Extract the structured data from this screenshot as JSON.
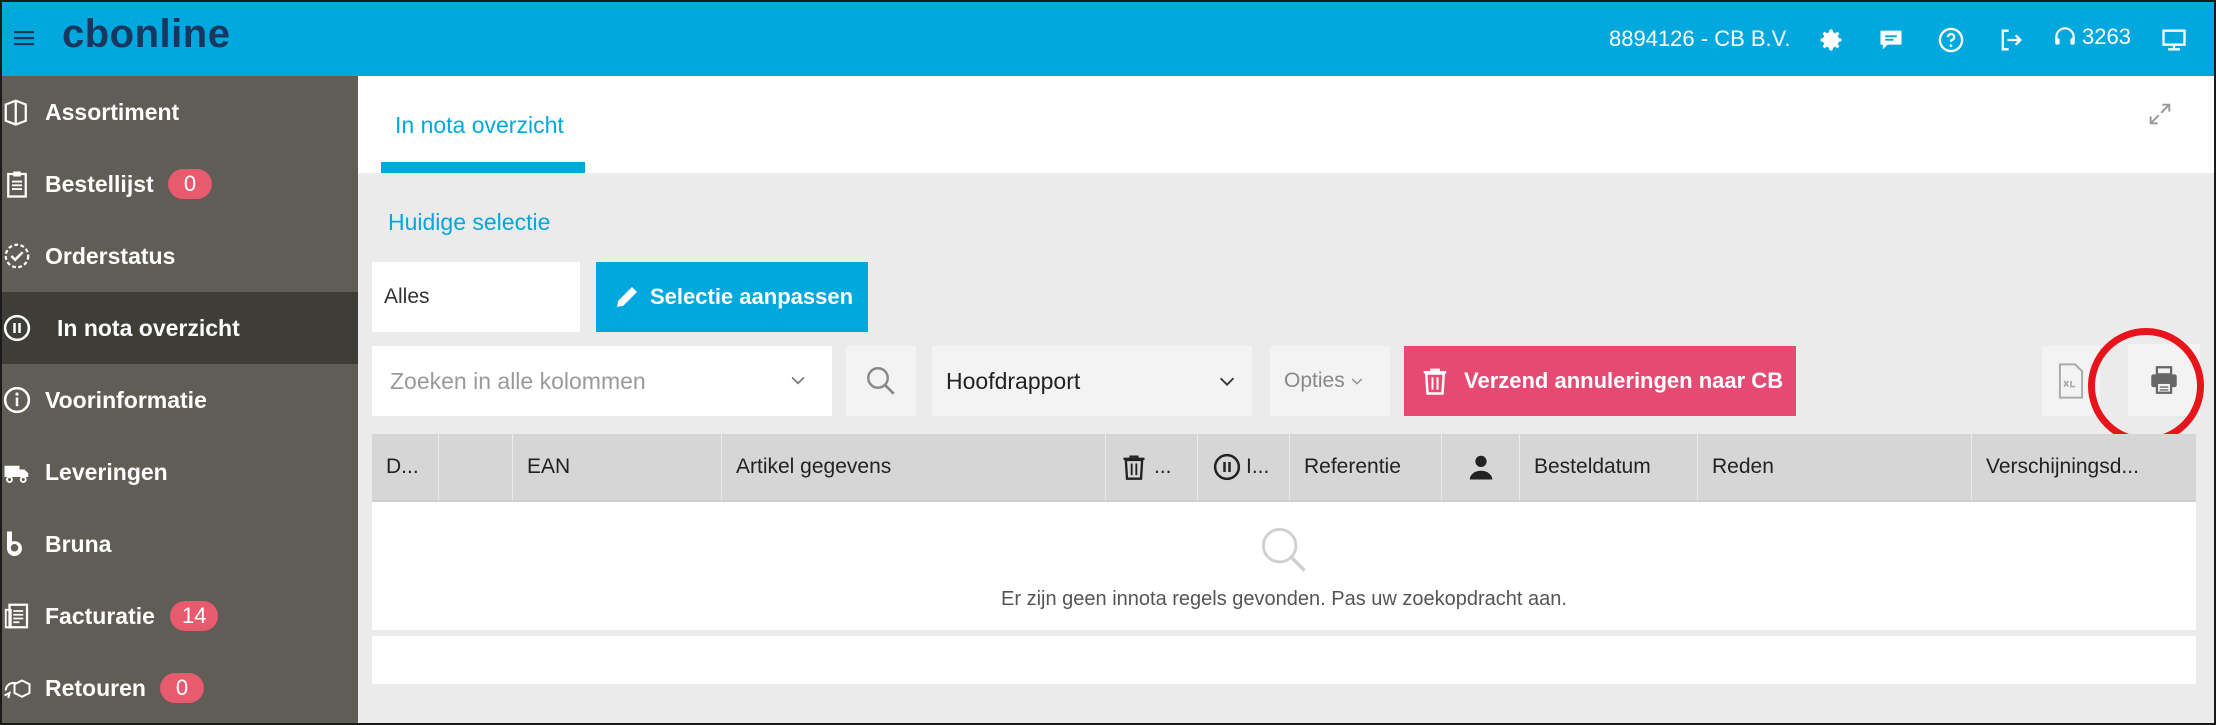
{
  "app": {
    "logo": "cbonline"
  },
  "header": {
    "account": "8894126 - CB B.V.",
    "support_number": "3263"
  },
  "sidebar": {
    "items": [
      {
        "label": "Assortiment",
        "icon": "books-icon",
        "badge": ""
      },
      {
        "label": "Bestellijst",
        "icon": "clipboard-icon",
        "badge": "0"
      },
      {
        "label": "Orderstatus",
        "icon": "check-circle-icon",
        "badge": ""
      },
      {
        "label": "In nota overzicht",
        "icon": "pause-circle-icon",
        "badge": "",
        "active": true
      },
      {
        "label": "Voorinformatie",
        "icon": "info-icon",
        "badge": ""
      },
      {
        "label": "Leveringen",
        "icon": "truck-icon",
        "badge": ""
      },
      {
        "label": "Bruna",
        "icon": "bruna-logo-icon",
        "badge": ""
      },
      {
        "label": "Facturatie",
        "icon": "invoice-icon",
        "badge": "14"
      },
      {
        "label": "Retouren",
        "icon": "return-icon",
        "badge": "0"
      }
    ]
  },
  "tabs": {
    "active_label": "In nota overzicht"
  },
  "selection": {
    "title": "Huidige selectie",
    "value": "Alles",
    "edit_label": "Selectie aanpassen"
  },
  "toolbar": {
    "search_placeholder": "Zoeken in alle kolommen",
    "report_value": "Hoofdrapport",
    "options_label": "Opties",
    "cancel_label": "Verzend annuleringen naar CB"
  },
  "grid": {
    "columns": [
      "D...",
      "",
      "EAN",
      "Artikel gegevens",
      "...",
      "I...",
      "Referentie",
      "",
      "Besteldatum",
      "Reden",
      "Verschijningsd..."
    ],
    "empty_message": "Er zijn geen innota regels gevonden. Pas uw zoekopdracht aan."
  },
  "colors": {
    "header_bg": "#00a8dd",
    "sidebar_bg": "#5f5d55",
    "badge": "#e85a6e",
    "cancel_button": "#e64a73",
    "highlight_ring": "#e8141c"
  }
}
